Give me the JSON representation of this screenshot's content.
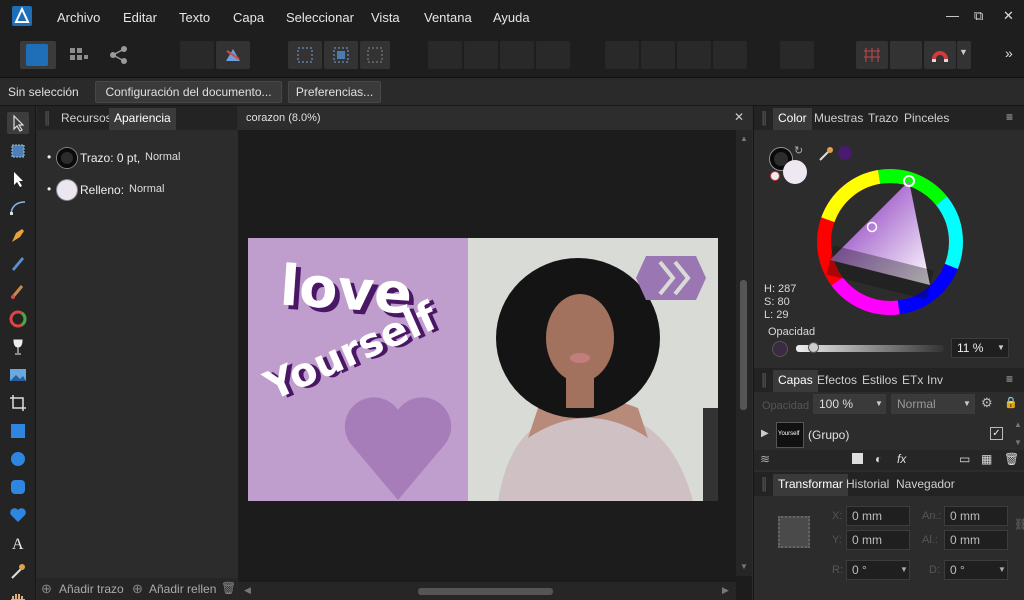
{
  "menu": [
    "Archivo",
    "Editar",
    "Texto",
    "Capa",
    "Seleccionar",
    "Vista",
    "Ventana",
    "Ayuda"
  ],
  "window_controls": {
    "minimize": "—",
    "restore": "⧉",
    "close": "✕"
  },
  "toolbar": {
    "overflow": "»"
  },
  "context_bar": {
    "status": "Sin selección",
    "doc_setup": "Configuración del documento...",
    "preferences": "Preferencias..."
  },
  "left_panel": {
    "tabs": [
      "Recursos",
      "Apariencia"
    ],
    "stroke_label": "Trazo: 0 pt,",
    "stroke_mode": "Normal",
    "fill_label": "Relleno:",
    "fill_mode": "Normal",
    "add_stroke": "Añadir trazo",
    "add_fill": "Añadir rellen"
  },
  "document": {
    "tab_title": "corazon (8.0%)",
    "text_love": "love",
    "text_yourself": "Yourself"
  },
  "color_panel": {
    "tabs": [
      "Color",
      "Muestras",
      "Trazo",
      "Pinceles"
    ],
    "h": "H: 287",
    "s": "S: 80",
    "l": "L: 29",
    "opacity_label": "Opacidad",
    "opacity_value": "11 %",
    "swatch_color": "#4a1a6e"
  },
  "layers_panel": {
    "tabs": [
      "Capas",
      "Efectos",
      "Estilos",
      "ETx",
      "Inv"
    ],
    "opacity_label": "Opacidad",
    "opacity_value": "100 %",
    "blend_mode": "Normal",
    "layer_name": "(Grupo)",
    "thumb_text": "Yourself"
  },
  "transform_panel": {
    "tabs": [
      "Transformar",
      "Historial",
      "Navegador"
    ],
    "x_label": "X:",
    "x_value": "0 mm",
    "y_label": "Y:",
    "y_value": "0 mm",
    "w_label": "An.:",
    "w_value": "0 mm",
    "h_label": "Al.:",
    "h_value": "0 mm",
    "r_label": "R:",
    "r_value": "0 °",
    "s_label": "D:",
    "s_value": "0 °"
  },
  "colors": {
    "accent": "#3a8fd8",
    "doc_left": "#bf9dcc",
    "heart": "#a67db8",
    "text_dark": "#4a1766",
    "hive": "#9a77b2"
  }
}
